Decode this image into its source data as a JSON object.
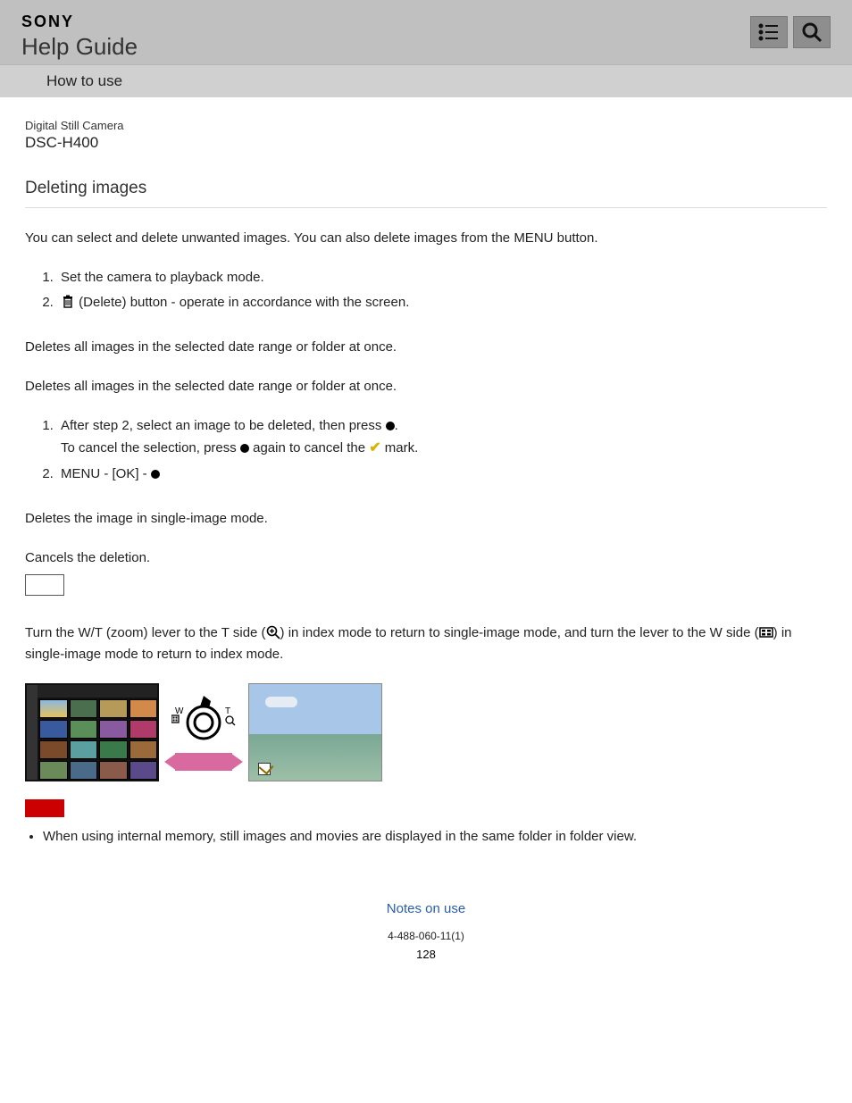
{
  "brand": {
    "logo": "SONY",
    "title": "Help Guide"
  },
  "subnav": {
    "label": "How to use"
  },
  "icons": {
    "toc": "toc-icon",
    "search": "search-icon"
  },
  "meta": {
    "category": "Digital Still Camera",
    "model": "DSC-H400"
  },
  "article": {
    "title": "Deleting images",
    "intro": "You can select and delete unwanted images. You can also delete images from the MENU button.",
    "steps1": {
      "s1": "Set the camera to playback mode.",
      "s2a": "(Delete) button - operate in accordance with the screen."
    },
    "p1": "Deletes all images in the selected date range or folder at once.",
    "p2": "Deletes all images in the selected date range or folder at once.",
    "steps2": {
      "s1a": "After step 2, select an image to be deleted, then press ",
      "s1b": ".",
      "s1c": "To cancel the selection, press ",
      "s1d": " again to cancel the ",
      "s1e": " mark.",
      "s2": "MENU - [OK] - "
    },
    "p3": "Deletes the image in single-image mode.",
    "p4": "Cancels the deletion.",
    "zoom_a": "Turn the W/T (zoom) lever to the T side (",
    "zoom_b": ") in index mode to return to single-image mode, and turn the lever to the W side (",
    "zoom_c": ") in single-image mode to return to index mode.",
    "lever_labels": {
      "w": "W",
      "t": "T"
    },
    "note1": "When using internal memory, still images and movies are displayed in the same folder in folder view."
  },
  "footer": {
    "link": "Notes on use",
    "code": "4-488-060-11(1)",
    "page": "128"
  }
}
